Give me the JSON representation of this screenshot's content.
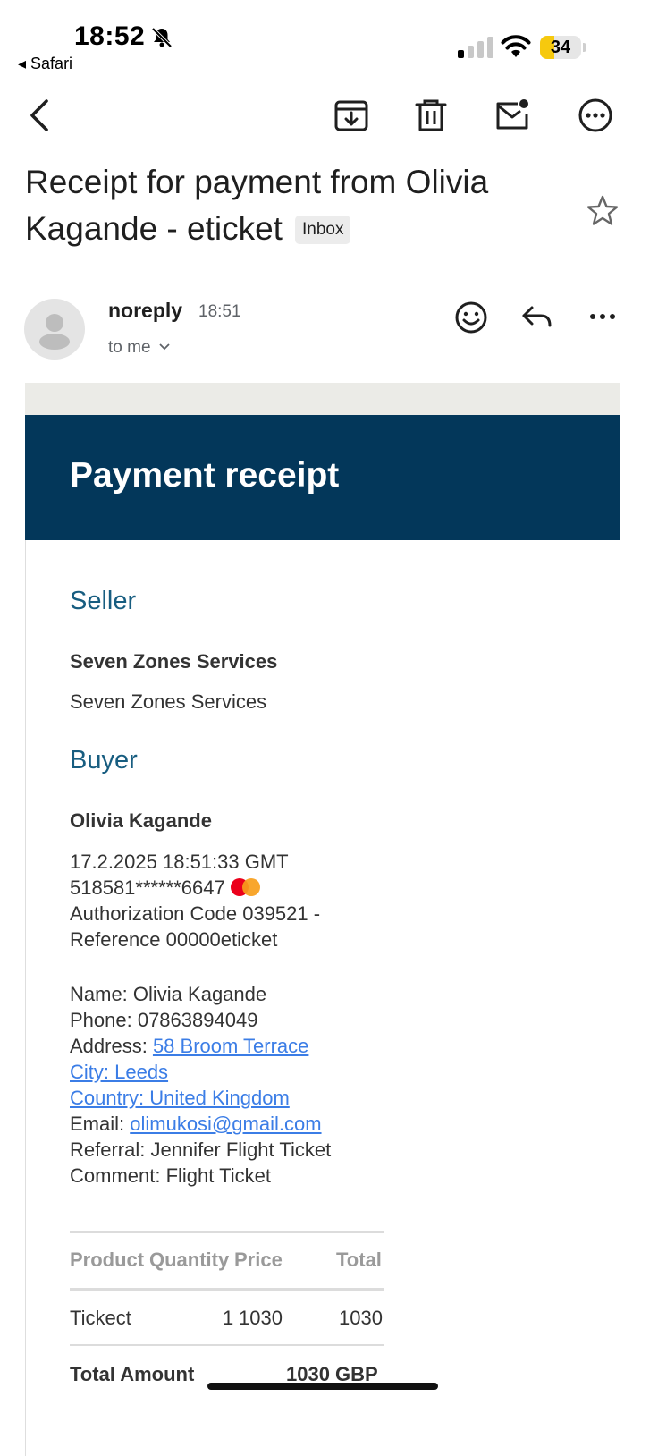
{
  "status_bar": {
    "time": "18:52",
    "back_app": "◂ Safari",
    "battery": "34",
    "battery_level_percent": 34
  },
  "toolbar": {
    "icons": [
      "back-arrow-icon",
      "archive-icon",
      "delete-icon",
      "mark-unread-icon",
      "more-icon"
    ]
  },
  "email": {
    "subject": "Receipt for payment from Olivia Kagande - eticket",
    "label": "Inbox",
    "sender": "noreply",
    "time": "18:51",
    "recipient": "to me"
  },
  "receipt": {
    "header_title": "Payment receipt",
    "seller_heading": "Seller",
    "seller_name_bold": "Seven Zones Services",
    "seller_name": "Seven Zones Services",
    "buyer_heading": "Buyer",
    "buyer_name": "Olivia Kagande",
    "datetime": "17.2.2025 18:51:33 GMT",
    "card_number": "518581******6647",
    "auth_line1": "Authorization Code 039521 -",
    "auth_line2": "Reference 00000eticket",
    "name_line": "Name: Olivia Kagande",
    "phone_line": "Phone: 07863894049",
    "address_label": "Address: ",
    "address_value": "58 Broom Terrace",
    "city_line": "City: Leeds",
    "country_line": "Country: United Kingdom",
    "email_label": "Email: ",
    "email_value": "olimukosi@gmail.com",
    "referral_line": "Referral: Jennifer Flight Ticket",
    "comment_line": "Comment: Flight Ticket",
    "table": {
      "headers": [
        "Product",
        "Quantity",
        "Price",
        "Total"
      ],
      "rows": [
        {
          "product": "Tickect",
          "quantity": "1",
          "price": "1030",
          "total": "1030"
        }
      ],
      "total_label": "Total Amount",
      "total_value": "1030 GBP"
    }
  }
}
